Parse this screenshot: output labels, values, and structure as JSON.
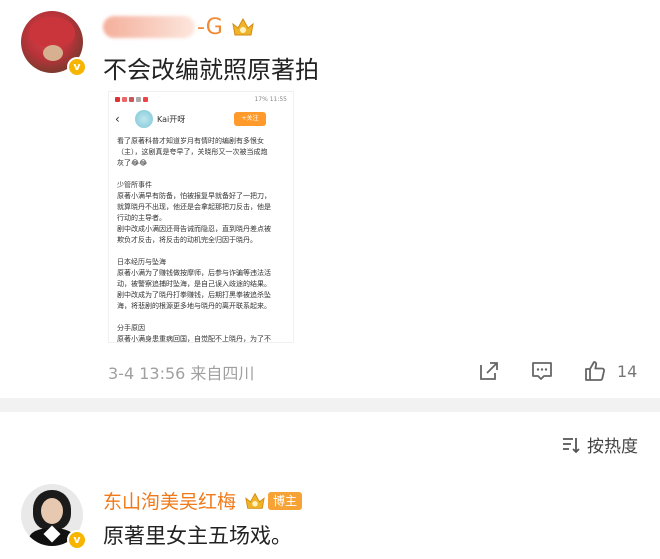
{
  "post": {
    "username_suffix": "-G",
    "text": "不会改编就照原著拍",
    "meta": "3-4 13:56  来自四川",
    "like_count": "14",
    "embedded_screenshot": {
      "status_time": "11:55",
      "status_battery": "17%",
      "account_name": "Kai开呀",
      "follow_label": "+关注",
      "lines": [
        "看了原著科普才知道岁月有情时的编剧有多恨女",
        "（主），这剧真是夸早了，关晓彤又一次被当成炮",
        "灰了😂😂",
        "",
        "少管所事件",
        "原著小满早有防备，怕被报复早就备好了一把刀，",
        "就算晓丹不出现，他还是会拿起那把刀反击，他是",
        "行动的主导者。",
        "剧中改成小满因还哥告诫而隐忍，直到晓丹差点被",
        "欺负才反击，将反击的动机完全归因于晓丹。",
        "",
        "日本经历与坠海",
        "原著小满为了赚钱做按摩师，后参与诈骗等违法活",
        "动，被警察追捕时坠海，是自己误入歧途的结果。",
        "剧中改成为了晓丹打拳赚钱，后期打黑拳被追杀坠",
        "海，将悲剧的根源更多地与晓丹的离开联系起来。",
        "",
        "分手原因",
        "原著小满身患重病回国，自觉配不上晓丹，为了不"
      ]
    }
  },
  "comments": {
    "sort_label": "按热度",
    "items": [
      {
        "username": "东山洵美吴红梅",
        "badge": "博主",
        "text": "原著里女主五场戏。"
      }
    ]
  },
  "colors": {
    "accent_orange": "#f07a1a",
    "vip_gold": "#f7b500",
    "meta_gray": "#a0a0a0"
  }
}
